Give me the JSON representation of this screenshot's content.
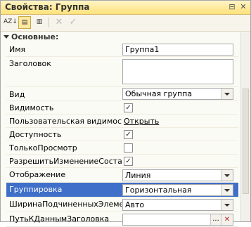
{
  "window": {
    "title": "Свойства: Группа"
  },
  "toolbar": {
    "buttons": [
      {
        "label": "AZ↓",
        "icon": "sort-alpha-icon"
      },
      {
        "label": "▤",
        "icon": "categories-icon"
      },
      {
        "label": "▥",
        "icon": "filter-icon"
      },
      {
        "label": "✕",
        "icon": "close-icon"
      },
      {
        "label": "✓",
        "icon": "check-icon"
      }
    ]
  },
  "group_label": "Основные:",
  "props": {
    "name": {
      "label": "Имя",
      "value": "Группа1"
    },
    "header": {
      "label": "Заголовок",
      "value": ""
    },
    "view": {
      "label": "Вид",
      "value": "Обычная группа"
    },
    "visibility": {
      "label": "Видимость",
      "checked": true
    },
    "user_visibility": {
      "label": "Пользовательская видимость",
      "link": "Открыть"
    },
    "enabled": {
      "label": "Доступность",
      "checked": true
    },
    "readonly": {
      "label": "ТолькоПросмотр",
      "checked": false
    },
    "allow_change": {
      "label": "РазрешитьИзменениеСостава",
      "checked": true
    },
    "display": {
      "label": "Отображение",
      "value": "Линия"
    },
    "grouping": {
      "label": "Группировка",
      "value": "Горизонтальная"
    },
    "children_width": {
      "label": "ШиринаПодчиненныхЭлементов",
      "value": "Авто"
    },
    "header_data_path": {
      "label": "ПутьКДаннымЗаголовка",
      "value": ""
    }
  },
  "glyphs": {
    "check": "✓",
    "dots": "...",
    "clear": "✕",
    "pin": "⊟",
    "close": "✕"
  }
}
